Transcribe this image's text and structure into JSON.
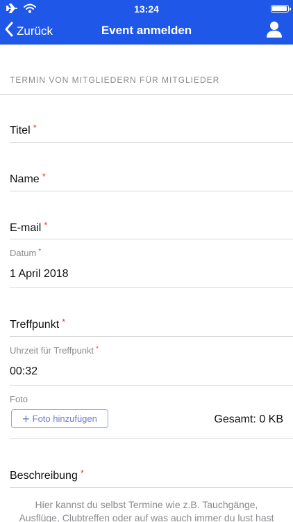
{
  "status_bar": {
    "time": "13:24",
    "battery_level": 0.95
  },
  "nav": {
    "back_label": "Zurück",
    "title": "Event anmelden",
    "back_icon": "chevron-left-icon",
    "user_icon": "user-icon"
  },
  "form": {
    "section_header": "TERMIN VON MITGLIEDERN FÜR MITGLIEDER",
    "required_marker": "*",
    "title_label": "Titel",
    "name_label": "Name",
    "email_label": "E-mail",
    "date_label": "Datum",
    "date_value": "1 April 2018",
    "meeting_point_label": "Treffpunkt",
    "meeting_time_label": "Uhrzeit für Treffpunkt",
    "meeting_time_value": "00:32",
    "photo_label": "Foto",
    "add_photo_label": "Foto hinzufügen",
    "total_size": "Gesamt: 0 KB",
    "description_label": "Beschreibung",
    "description_hint": "Hier kannst du selbst Termine wie z.B. Tauchgänge, Ausflüge, Clubtreffen oder auf was auch immer du lust hast"
  },
  "colors": {
    "header_bg": "#1f57e8",
    "required": "#e0413a",
    "photo_button": "#6c7bcf"
  }
}
